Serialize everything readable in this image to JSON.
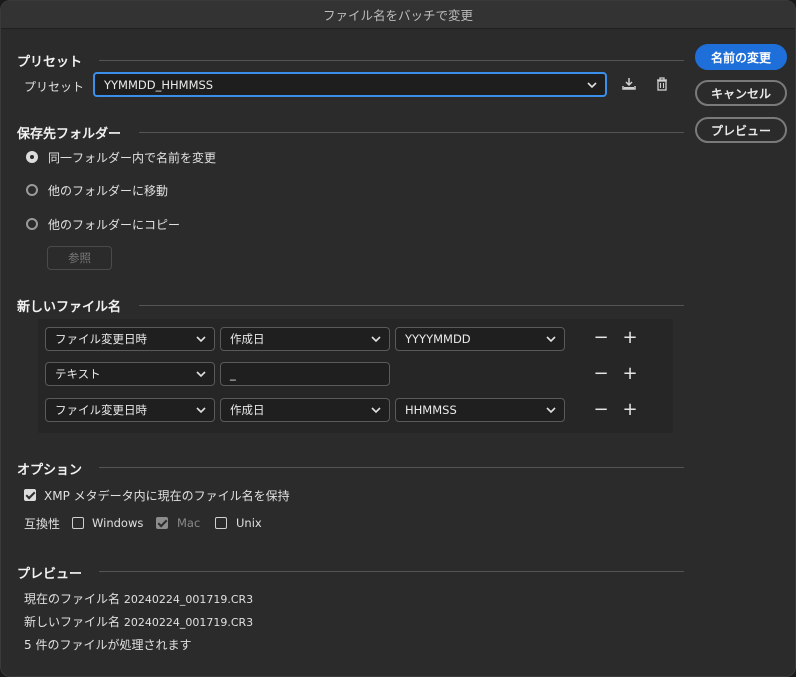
{
  "window": {
    "title": "ファイル名をバッチで変更"
  },
  "buttons": {
    "rename": "名前の変更",
    "cancel": "キャンセル",
    "preview": "プレビュー",
    "browse": "参照"
  },
  "preset": {
    "section_title": "プリセット",
    "label": "プリセット",
    "value": "YYMMDD_HHMMSS"
  },
  "destination": {
    "section_title": "保存先フォルダー",
    "options": [
      {
        "label": "同一フォルダー内で名前を変更",
        "checked": true
      },
      {
        "label": "他のフォルダーに移動",
        "checked": false
      },
      {
        "label": "他のフォルダーにコピー",
        "checked": false
      }
    ]
  },
  "new_filename": {
    "section_title": "新しいファイル名",
    "rows": [
      {
        "type": "ファイル変更日時",
        "field": "作成日",
        "format": "YYYYMMDD"
      },
      {
        "type": "テキスト",
        "text": "_"
      },
      {
        "type": "ファイル変更日時",
        "field": "作成日",
        "format": "HHMMSS"
      }
    ],
    "minus": "−",
    "plus": "+"
  },
  "options": {
    "section_title": "オプション",
    "preserve_xmp": {
      "label": "XMP メタデータ内に現在のファイル名を保持",
      "checked": true
    },
    "compat_label": "互換性",
    "compat": [
      {
        "label": "Windows",
        "checked": false,
        "disabled": false
      },
      {
        "label": "Mac",
        "checked": true,
        "disabled": true
      },
      {
        "label": "Unix",
        "checked": false,
        "disabled": false
      }
    ]
  },
  "preview": {
    "section_title": "プレビュー",
    "current_label": "現在のファイル名",
    "current_value": "20240224_001719.CR3",
    "new_label": "新しいファイル名",
    "new_value": "20240224_001719.CR3",
    "count_text": "5 件のファイルが処理されます"
  },
  "colors": {
    "accent": "#1e6fd9",
    "focus": "#3b8eea"
  },
  "icons": [
    "chevron-down-icon",
    "save-preset-icon",
    "trash-icon"
  ]
}
